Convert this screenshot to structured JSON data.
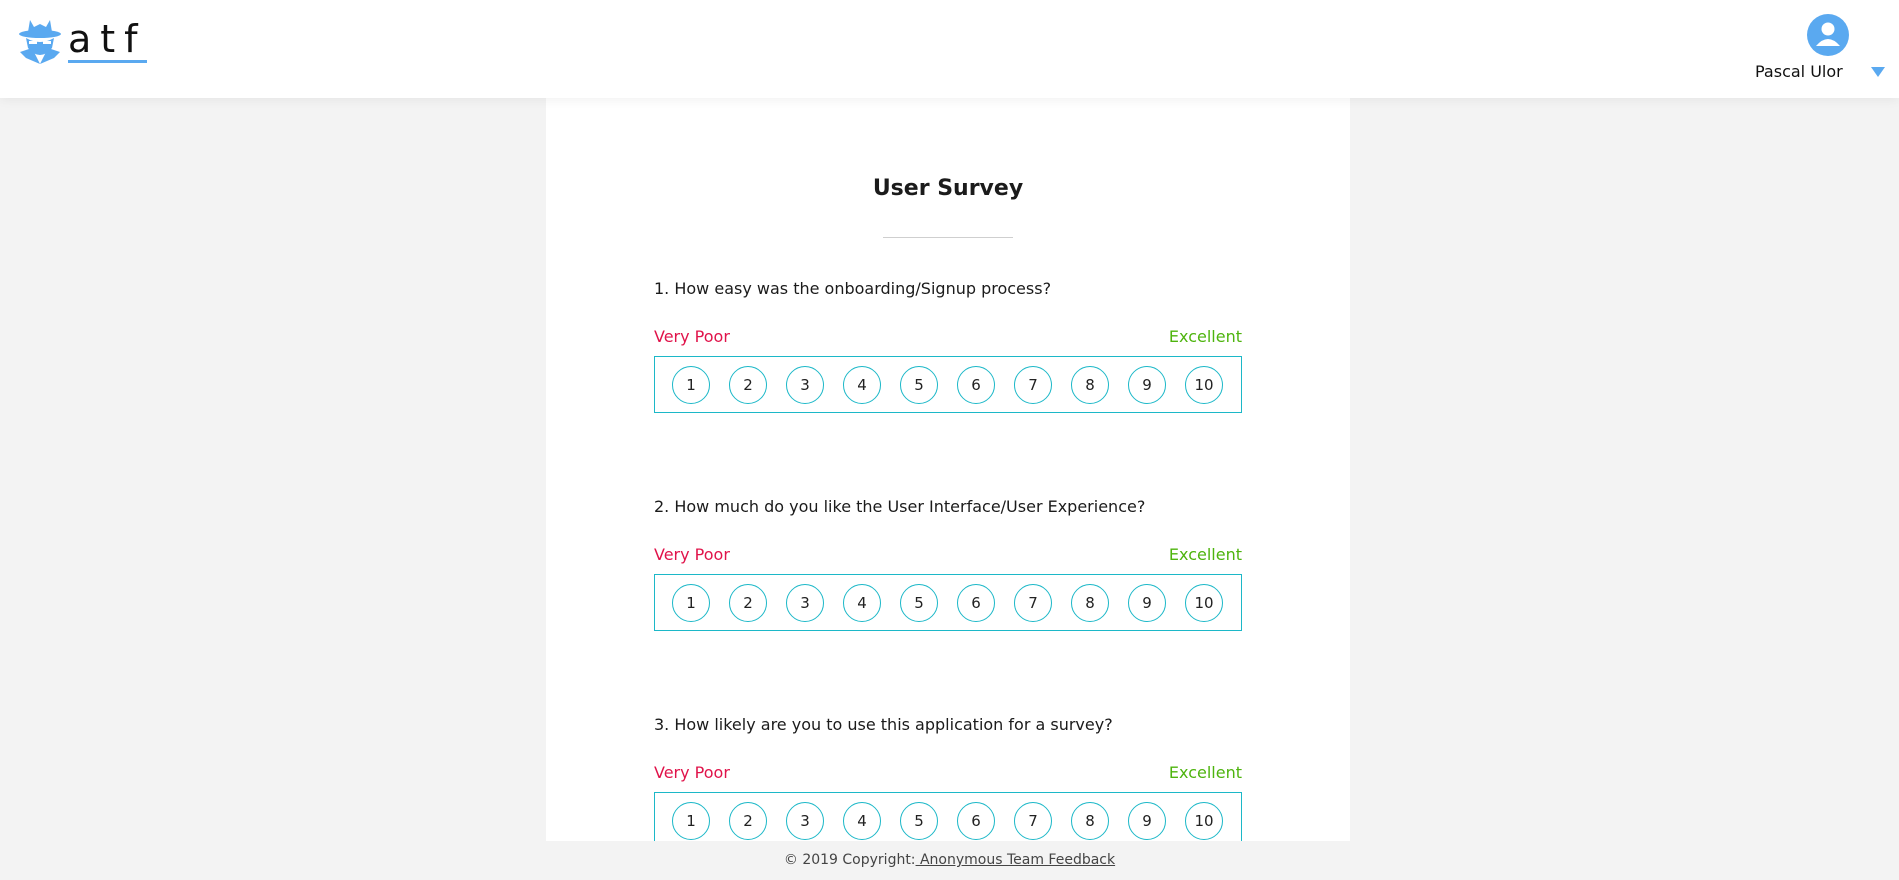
{
  "header": {
    "logo_text": "atf",
    "username": "Pascal Ulor",
    "accent_color": "#5aa9f0"
  },
  "survey": {
    "title": "User Survey",
    "low_label": "Very Poor",
    "high_label": "Excellent",
    "scale": [
      "1",
      "2",
      "3",
      "4",
      "5",
      "6",
      "7",
      "8",
      "9",
      "10"
    ],
    "questions": [
      {
        "text": "1. How easy was the onboarding/Signup process?"
      },
      {
        "text": "2. How much do you like the User Interface/User Experience?"
      },
      {
        "text": "3. How likely are you to use this application for a survey?"
      }
    ],
    "colors": {
      "low": "#e0134a",
      "high": "#4eb40e",
      "scale_border": "#1cb8c8"
    }
  },
  "footer": {
    "copyright": "© 2019 Copyright:",
    "link": " Anonymous Team Feedback"
  }
}
